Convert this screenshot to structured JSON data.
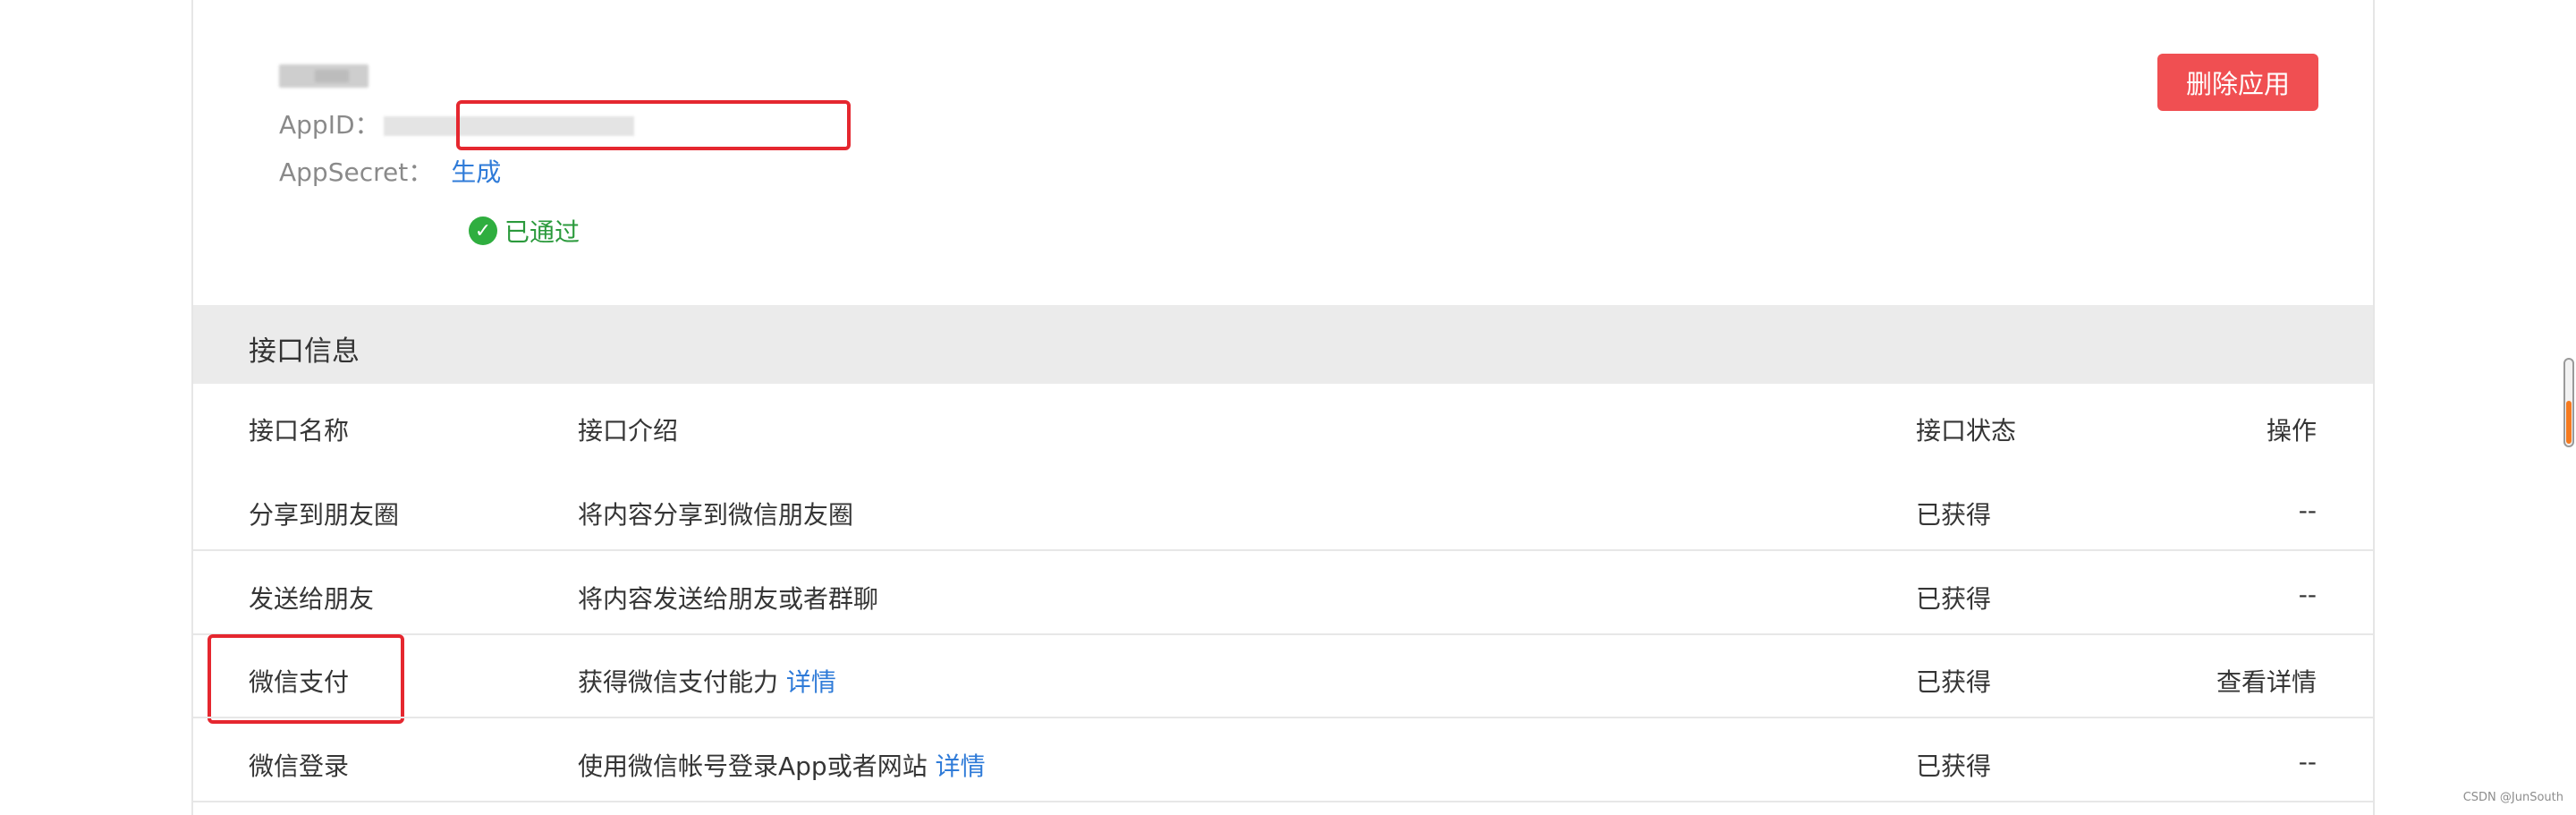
{
  "app": {
    "appid_label": "AppID：",
    "appsecret_label": "AppSecret：",
    "generate_link": "生成",
    "status_text": "已通过",
    "delete_button": "删除应用"
  },
  "interface_section": {
    "title": "接口信息",
    "columns": [
      "接口名称",
      "接口介绍",
      "接口状态",
      "操作"
    ],
    "rows": [
      {
        "name": "分享到朋友圈",
        "intro": "将内容分享到微信朋友圈",
        "detail_link": "",
        "status": "已获得",
        "action": "--"
      },
      {
        "name": "发送给朋友",
        "intro": "将内容发送给朋友或者群聊",
        "detail_link": "",
        "status": "已获得",
        "action": "--"
      },
      {
        "name": "微信支付",
        "intro": "获得微信支付能力",
        "detail_link": "详情",
        "status": "已获得",
        "action": "查看详情"
      },
      {
        "name": "微信登录",
        "intro": "使用微信帐号登录App或者网站",
        "detail_link": "详情",
        "status": "已获得",
        "action": "--"
      }
    ]
  },
  "watermark": "CSDN @JunSouth",
  "colors": {
    "accent_link": "#2f7bd8",
    "delete_button": "#f04f52",
    "success": "#2fae3f",
    "highlight_box": "#e5272f"
  }
}
